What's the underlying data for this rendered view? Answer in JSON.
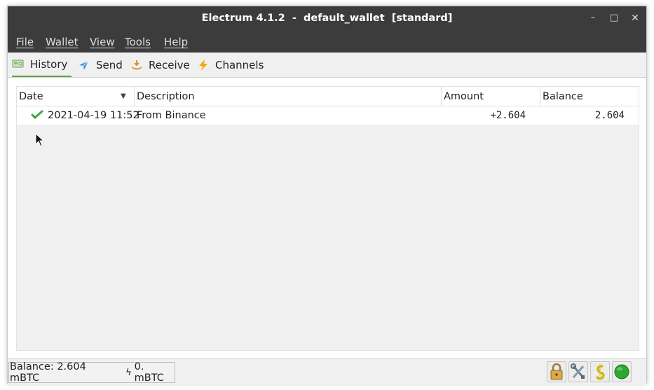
{
  "window": {
    "title": "Electrum 4.1.2  -  default_wallet  [standard]",
    "controls": {
      "minimize": "–",
      "maximize": "□",
      "close": "✕"
    }
  },
  "menubar": {
    "items": [
      "File",
      "Wallet",
      "View",
      "Tools",
      "Help"
    ]
  },
  "tabs": [
    {
      "label": "History",
      "icon": "history-icon",
      "active": true
    },
    {
      "label": "Send",
      "icon": "send-icon",
      "active": false
    },
    {
      "label": "Receive",
      "icon": "receive-icon",
      "active": false
    },
    {
      "label": "Channels",
      "icon": "lightning-icon",
      "active": false
    }
  ],
  "history": {
    "columns": [
      "Date",
      "Description",
      "Amount",
      "Balance"
    ],
    "sort_column": "Date",
    "rows": [
      {
        "status_icon": "confirmed-check-icon",
        "date": "2021-04-19 11:52",
        "description": "From Binance",
        "amount": "+2.604",
        "balance": "2.604"
      }
    ]
  },
  "statusbar": {
    "balance": "Balance: 2.604 mBTC",
    "lightning_balance": "0. mBTC",
    "lightning_glyph": "ϟ",
    "buttons": [
      "lock-icon",
      "preferences-icon",
      "seed-icon",
      "network-status-icon"
    ]
  },
  "colors": {
    "titlebar": "#3c3c3c",
    "active_tab_underline": "#5aa63a",
    "network_status": "#2ea82e"
  }
}
